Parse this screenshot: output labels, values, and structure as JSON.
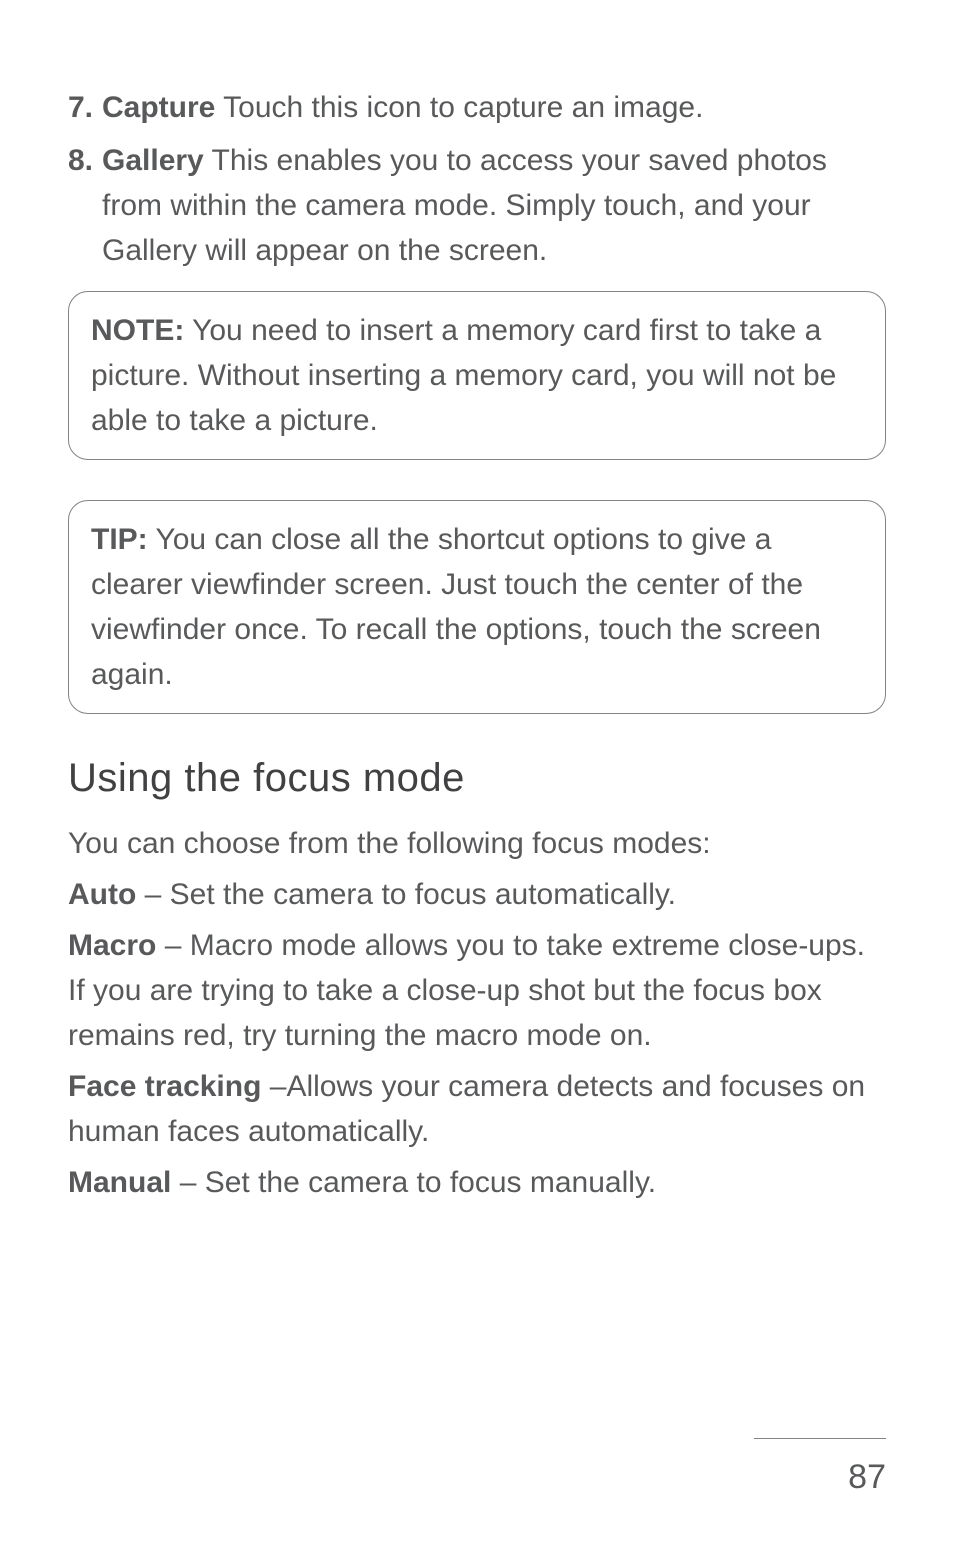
{
  "list": {
    "items": [
      {
        "num": "7.",
        "label": "Capture",
        "text": " Touch this icon to capture an image."
      },
      {
        "num": "8.",
        "label": "Gallery",
        "text": " This enables you to access your saved photos from within the camera mode. Simply touch, and your Gallery will appear on the screen."
      }
    ]
  },
  "note": {
    "label": "NOTE:",
    "text": " You need to insert a memory card first to take a picture. Without inserting a memory card, you will not be able to take a picture."
  },
  "tip": {
    "label": "TIP:",
    "text": " You can close all the shortcut options to give a clearer viewfinder screen. Just touch the center of the viewfinder once. To recall the options, touch the screen again."
  },
  "section": {
    "heading": "Using the focus mode",
    "intro": "You can choose from the following focus modes:",
    "modes": [
      {
        "label": "Auto",
        "text": " – Set the camera to focus automatically."
      },
      {
        "label": "Macro",
        "text": " – Macro mode allows you to take extreme close-ups. If you are trying to take a close-up shot but the focus box remains red, try turning the macro mode on."
      },
      {
        "label": "Face tracking",
        "text": " –Allows your camera detects and focuses on human faces automatically."
      },
      {
        "label": "Manual",
        "text": " – Set the camera to focus manually."
      }
    ]
  },
  "page_number": "87"
}
